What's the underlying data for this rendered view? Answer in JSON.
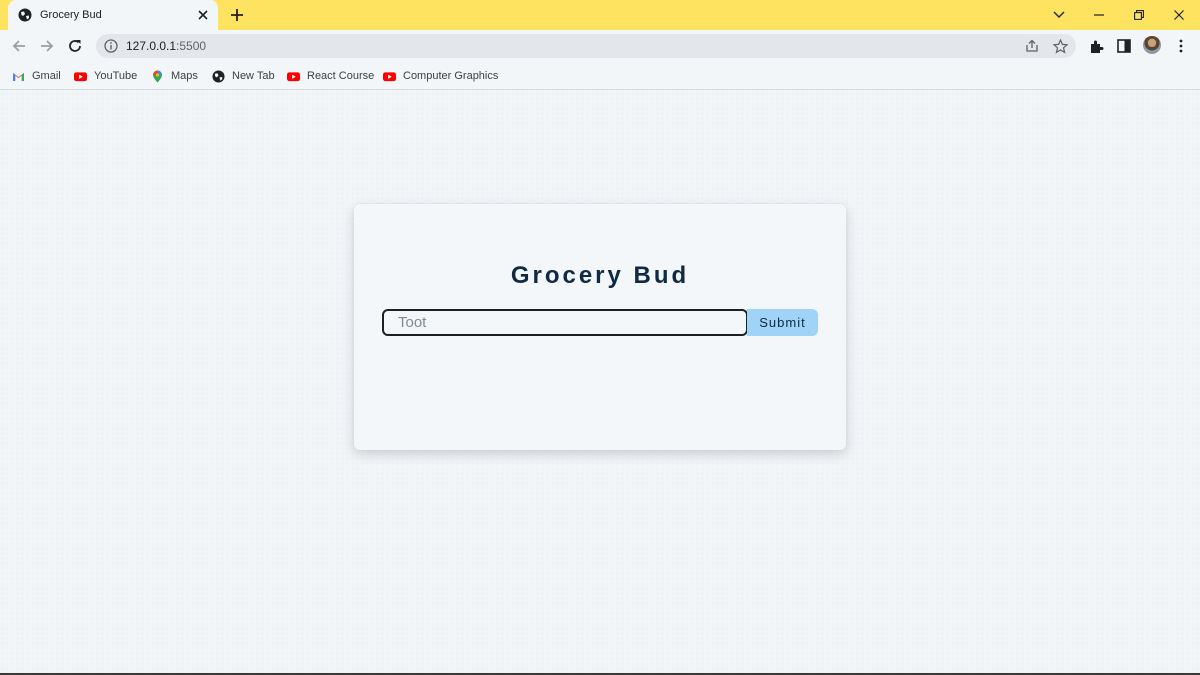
{
  "browser": {
    "tab": {
      "title": "Grocery Bud",
      "favicon": "globe-icon"
    },
    "address": {
      "host": "127.0.0.1",
      "port": ":5500"
    },
    "bookmarks": [
      {
        "label": "Gmail",
        "icon": "gmail-icon"
      },
      {
        "label": "YouTube",
        "icon": "youtube-icon"
      },
      {
        "label": "Maps",
        "icon": "maps-icon"
      },
      {
        "label": "New Tab",
        "icon": "globe-icon"
      },
      {
        "label": "React Course",
        "icon": "youtube-icon"
      },
      {
        "label": "Computer Graphics",
        "icon": "youtube-icon"
      }
    ],
    "colors": {
      "tabstrip": "#fde360",
      "toolbar": "#f3f6f9"
    }
  },
  "app": {
    "title": "Grocery Bud",
    "input": {
      "value": "Toot"
    },
    "submit_label": "Submit",
    "colors": {
      "title": "#102a43",
      "button": "#9fd3f7",
      "card": "#f3f7fa",
      "background": "#f1f5f8"
    }
  }
}
